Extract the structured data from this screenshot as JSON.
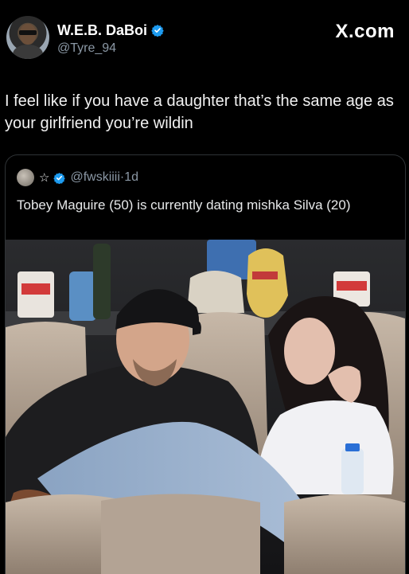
{
  "author": {
    "display_name": "W.E.B. DaBoi",
    "handle": "@Tyre_94",
    "verified": true,
    "avatar_icon": "profile-avatar"
  },
  "brand": "X.com",
  "tweet": {
    "text": "I feel like if you have a daughter that’s the same age as your girlfriend you’re wildin"
  },
  "quote": {
    "star": "☆",
    "handle": "@fwskiiii",
    "separator": "·",
    "time": "1d",
    "text": "Tobey Maguire (50) is currently dating mishka Silva (20)",
    "image_icon": "stadium-couple-photo"
  },
  "colors": {
    "background": "#000000",
    "verified_blue": "#1d9bf0",
    "secondary_text": "#8b98a5"
  }
}
